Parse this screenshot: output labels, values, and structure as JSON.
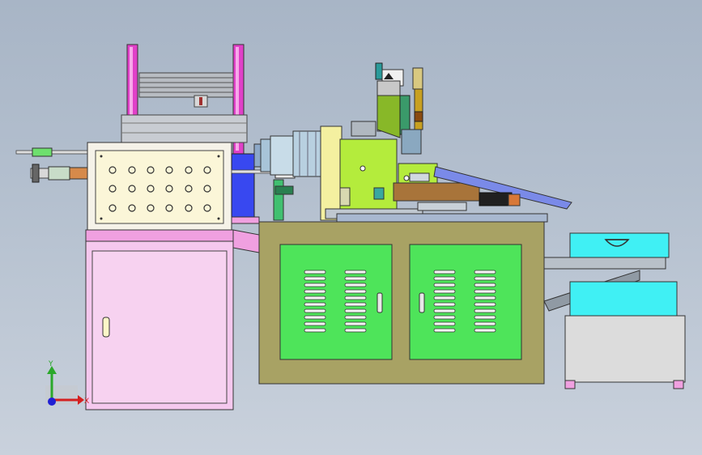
{
  "viewport": {
    "background_top": "#a8b5c6",
    "background_bottom": "#c9d1dc"
  },
  "triad": {
    "y_label": "Y",
    "x_label": "X",
    "y_color": "#2aa82a",
    "x_color": "#d42020",
    "z_color": "#2020d4"
  },
  "colors": {
    "magenta": "#e040c8",
    "pink_cabinet": "#f5c8ee",
    "olive_base": "#a8a264",
    "green_panel": "#4ee45a",
    "lime": "#b4ec3c",
    "cyan": "#40f0f4",
    "blue_block": "#3848f0",
    "grey_bin": "#dcdcdc"
  }
}
